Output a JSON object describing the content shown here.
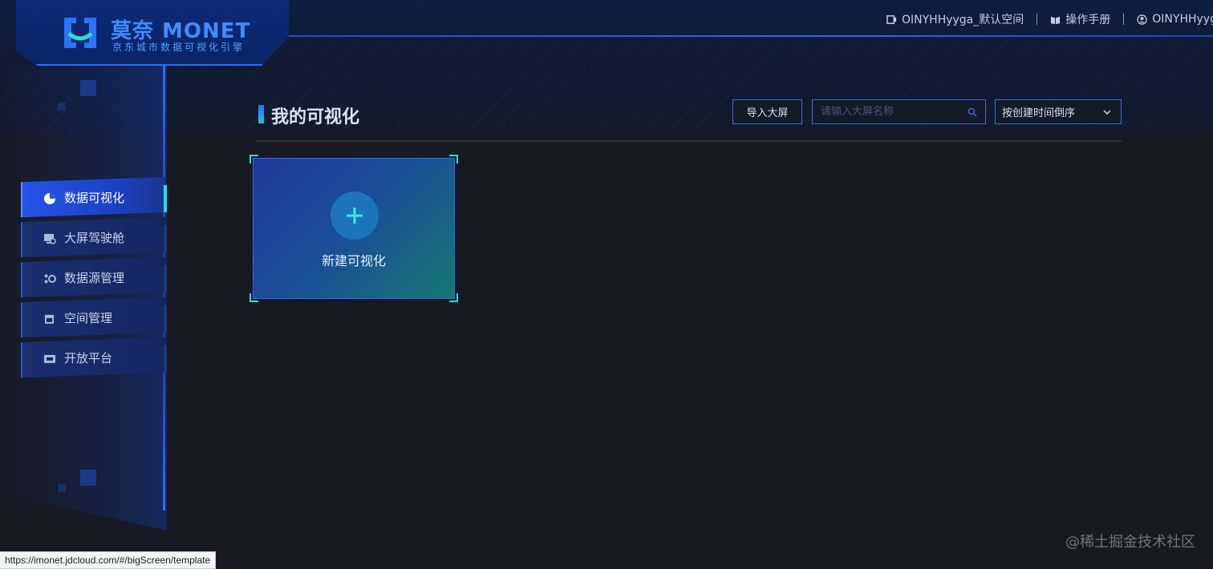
{
  "brand": {
    "title": "莫奈 MONET",
    "subtitle": "京东城市数据可视化引擎"
  },
  "top_nav": {
    "workspace": "OINYHHyyga_默认空间",
    "manual": "操作手册",
    "user": "OINYHHyyga"
  },
  "sidebar": {
    "items": [
      {
        "label": "数据可视化",
        "icon": "pie-chart-icon",
        "active": true
      },
      {
        "label": "大屏驾驶舱",
        "icon": "monitor-icon",
        "active": false
      },
      {
        "label": "数据源管理",
        "icon": "datasource-icon",
        "active": false
      },
      {
        "label": "空间管理",
        "icon": "space-icon",
        "active": false
      },
      {
        "label": "开放平台",
        "icon": "platform-icon",
        "active": false
      }
    ]
  },
  "main": {
    "title": "我的可视化",
    "import_button": "导入大屏",
    "search_placeholder": "请输入大屏名称",
    "search_value": "",
    "sort_selected": "按创建时间倒序",
    "new_card_label": "新建可视化"
  },
  "status_url": "https://imonet.jdcloud.com/#/bigScreen/template",
  "watermark": "@稀土掘金技术社区",
  "colors": {
    "accent": "#2f6bff",
    "active_marker": "#1ee0e8",
    "background": "#171a23"
  }
}
